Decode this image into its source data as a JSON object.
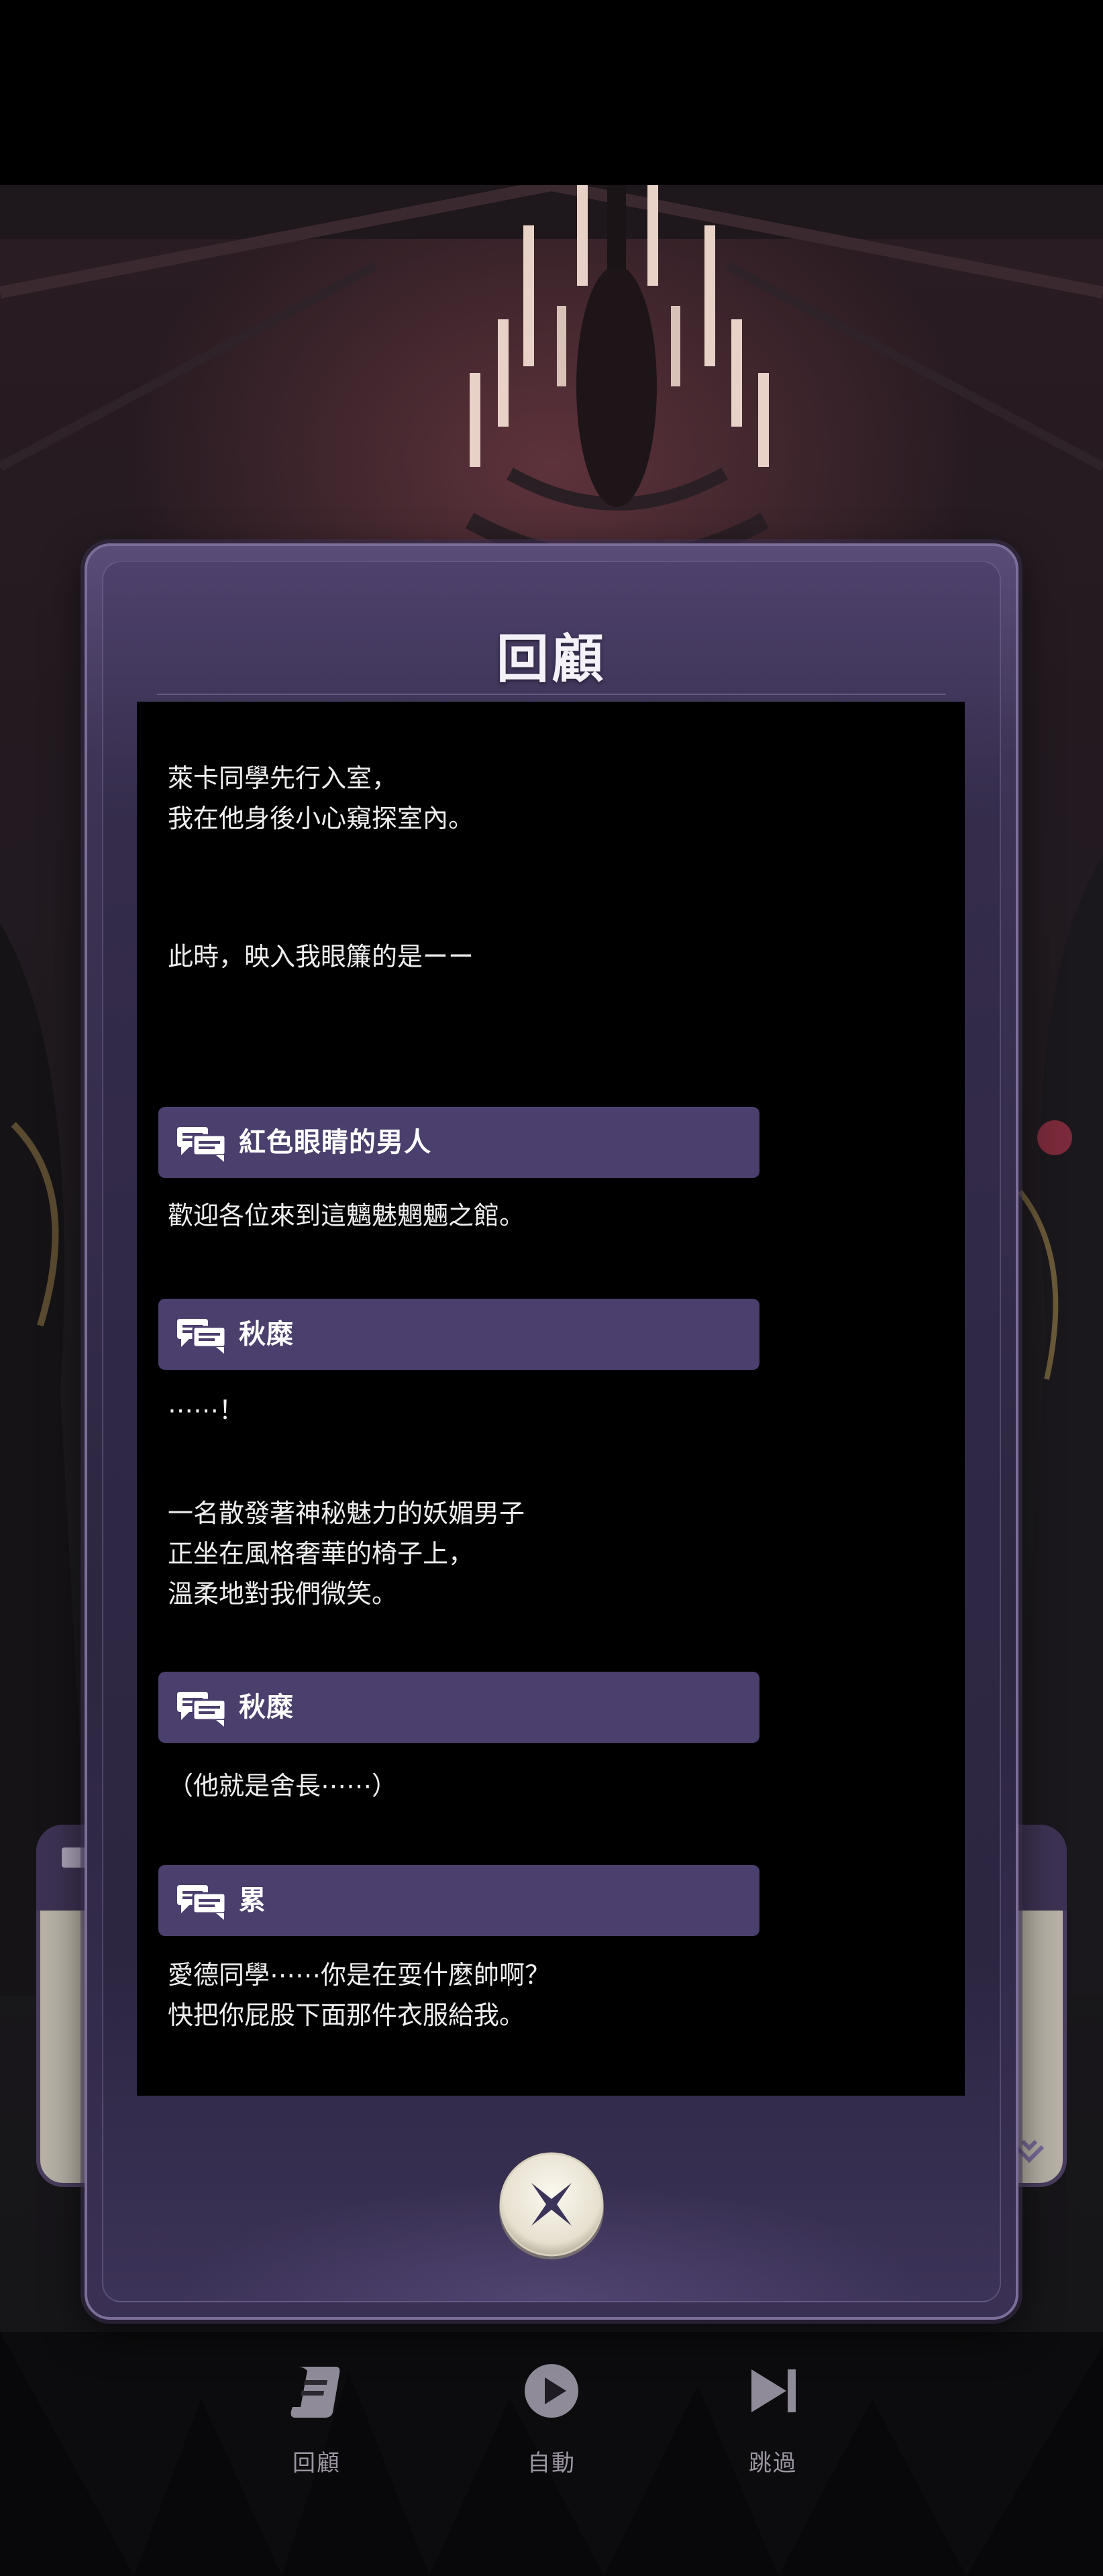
{
  "modal": {
    "title": "回顧",
    "log": [
      {
        "type": "narration",
        "text": "萊卡同學先行入室，\n我在他身後小心窺探室內。"
      },
      {
        "type": "narration",
        "text": "此時，映入我眼簾的是ーー"
      },
      {
        "type": "speaker",
        "name": "紅色眼睛的男人"
      },
      {
        "type": "narration",
        "text": "歡迎各位來到這魑魅魍魎之館。"
      },
      {
        "type": "speaker",
        "name": "秋糜"
      },
      {
        "type": "narration",
        "text": "⋯⋯！"
      },
      {
        "type": "narration",
        "text": "一名散發著神秘魅力的妖媚男子\n正坐在風格奢華的椅子上，\n溫柔地對我們微笑。"
      },
      {
        "type": "speaker",
        "name": "秋糜"
      },
      {
        "type": "narration",
        "text": "（他就是舍長⋯⋯）"
      },
      {
        "type": "speaker",
        "name": "累"
      },
      {
        "type": "narration",
        "text": "愛德同學⋯⋯你是在耍什麼帥啊？\n快把你屁股下面那件衣服給我。"
      }
    ],
    "close_icon": "close-x-icon"
  },
  "bottom_menu": {
    "review_label": "回顧",
    "auto_label": "自動",
    "skip_label": "跳過",
    "review_icon": "scroll-icon",
    "auto_icon": "play-icon",
    "skip_icon": "skip-forward-icon"
  },
  "colors": {
    "speaker_bar": "#4b3f6d",
    "modal_frame": "#3e3456",
    "log_background": "#000000",
    "menu_label": "#9a96a2"
  }
}
